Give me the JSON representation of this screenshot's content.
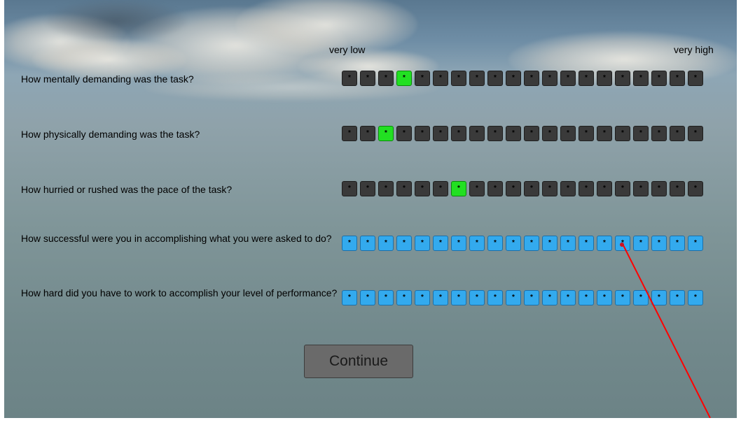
{
  "scale_labels": {
    "low": "very low",
    "high": "very high"
  },
  "questions": [
    {
      "text": "How mentally demanding was the task?",
      "style": "dark",
      "selected_index": 3
    },
    {
      "text": "How physically demanding was the task?",
      "style": "dark",
      "selected_index": 2
    },
    {
      "text": "How hurried or rushed was the pace of the task?",
      "style": "dark",
      "selected_index": 6
    },
    {
      "text": "How successful were you in accomplishing what you were asked to do?",
      "style": "blue",
      "selected_index": null
    },
    {
      "text": "How hard did you have to work to  accomplish your level of performance?",
      "style": "blue",
      "selected_index": null
    }
  ],
  "scale_steps": 20,
  "box_marker": "*",
  "continue_label": "Continue",
  "colors": {
    "dark_box": "#3a3a3a",
    "selected_box": "#22e022",
    "blue_box": "#33aaee",
    "laser": "#ff0000"
  }
}
